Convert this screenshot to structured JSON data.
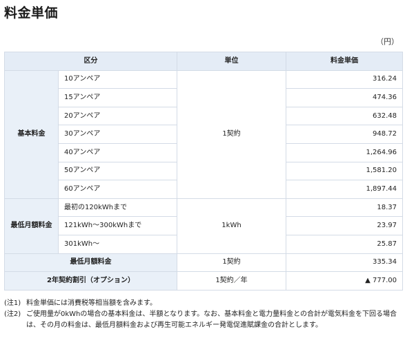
{
  "title": "料金単価",
  "unit_note": "（円）",
  "table": {
    "headers": {
      "category": "区分",
      "unit": "単位",
      "price": "料金単価"
    },
    "basic": {
      "group_label": "基本料金",
      "unit": "1契約",
      "rows": [
        {
          "label": "10アンペア",
          "value": "316.24"
        },
        {
          "label": "15アンペア",
          "value": "474.36"
        },
        {
          "label": "20アンペア",
          "value": "632.48"
        },
        {
          "label": "30アンペア",
          "value": "948.72"
        },
        {
          "label": "40アンペア",
          "value": "1,264.96"
        },
        {
          "label": "50アンペア",
          "value": "1,581.20"
        },
        {
          "label": "60アンペア",
          "value": "1,897.44"
        }
      ]
    },
    "minimum_monthly": {
      "group_label": "最低月額料金",
      "unit": "1kWh",
      "rows": [
        {
          "label": "最初の120kWhまで",
          "value": "18.37"
        },
        {
          "label": "121kWh〜300kWhまで",
          "value": "23.97"
        },
        {
          "label": "301kWh〜",
          "value": "25.87"
        }
      ]
    },
    "minimum_total": {
      "label": "最低月額料金",
      "unit": "1契約",
      "value": "335.34"
    },
    "two_year_discount": {
      "label": "2年契約割引（オプション）",
      "unit": "1契約／年",
      "value": "▲ 777.00"
    }
  },
  "notes": [
    {
      "mark": "(注1)",
      "text": "料金単価には消費税等相当額を含みます。"
    },
    {
      "mark": "(注2)",
      "text": "ご使用量が0kWhの場合の基本料金は、半額となります。なお、基本料金と電力量料金との合計が電気料金を下回る場合は、その月の料金は、最低月額料金および再生可能エネルギー発電促進賦課金の合計とします。"
    }
  ]
}
